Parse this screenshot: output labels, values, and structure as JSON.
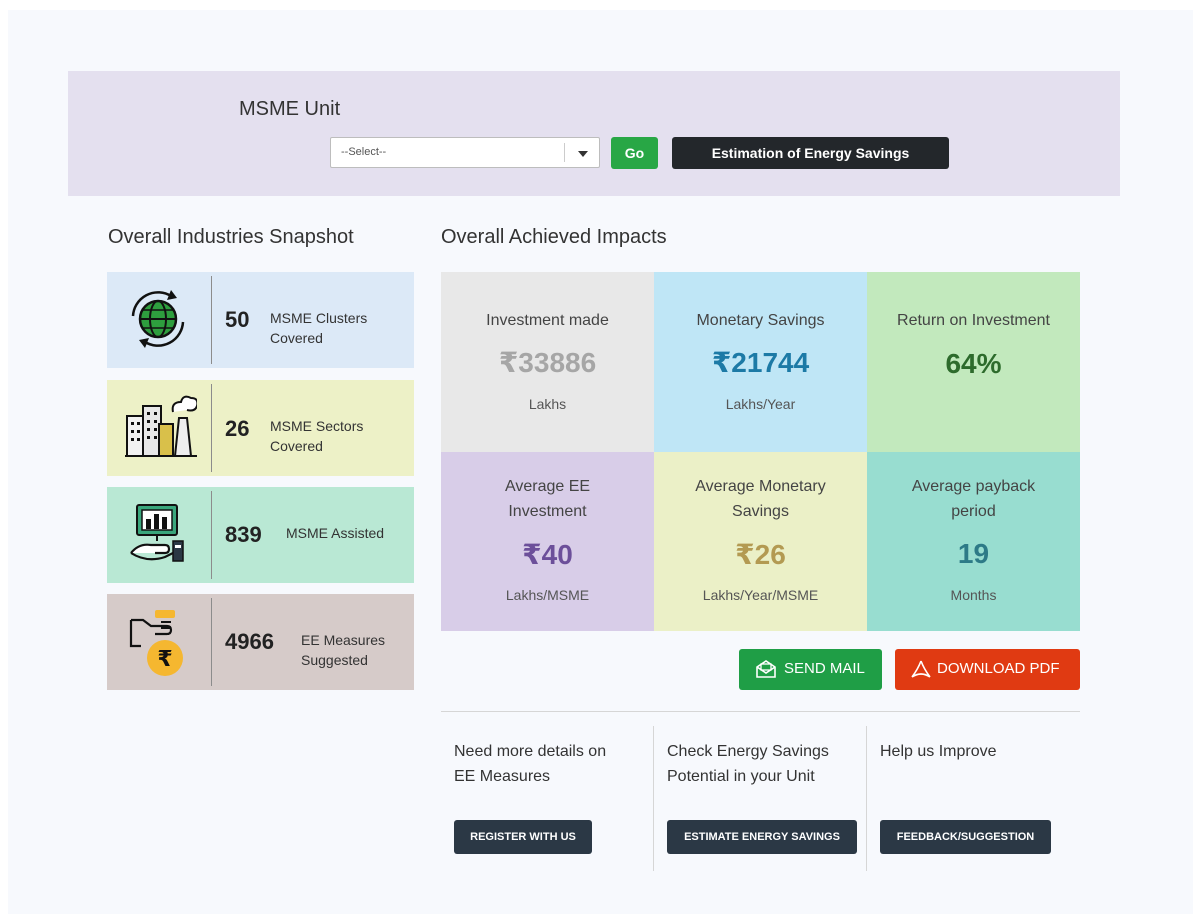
{
  "unit_panel": {
    "title": "MSME Unit",
    "select_value": "--Select--",
    "go_label": "Go",
    "estimation_label": "Estimation of Energy Savings"
  },
  "snapshot": {
    "title": "Overall Industries Snapshot",
    "cards": [
      {
        "number": "50",
        "label_line1": "MSME Clusters",
        "label_line2": "Covered",
        "icon": "globe-refresh-icon",
        "bg": "#dce9f7"
      },
      {
        "number": "26",
        "label_line1": "MSME Sectors",
        "label_line2": "Covered",
        "icon": "factory-buildings-icon",
        "bg": "#edf1c7"
      },
      {
        "number": "839",
        "label_line1": "MSME Assisted",
        "label_line2": "",
        "icon": "hand-chart-icon",
        "bg": "#b9e8d4"
      },
      {
        "number": "4966",
        "label_line1": "EE Measures",
        "label_line2": "Suggested",
        "icon": "rupee-bag-hand-icon",
        "bg": "#d6cbc9"
      }
    ]
  },
  "impacts": {
    "title": "Overall Achieved Impacts",
    "tiles": [
      {
        "label": "Investment made",
        "value": "₹33886",
        "unit": "Lakhs",
        "bg": "#e8e8e8",
        "color": "#a6a6a6"
      },
      {
        "label": "Monetary Savings",
        "value": "₹21744",
        "unit": "Lakhs/Year",
        "bg": "#bfe6f6",
        "color": "#1c7aa6"
      },
      {
        "label": "Return on Investment",
        "value": "64%",
        "unit": "",
        "bg": "#c2e9bd",
        "color": "#2d6b2c"
      },
      {
        "label_line1": "Average EE",
        "label_line2": "Investment",
        "value": "₹40",
        "unit": "Lakhs/MSME",
        "bg": "#d8cde8",
        "color": "#6c4f9a"
      },
      {
        "label_line1": "Average Monetary",
        "label_line2": "Savings",
        "value": "₹26",
        "unit": "Lakhs/Year/MSME",
        "bg": "#ebf0c7",
        "color": "#b39a52"
      },
      {
        "label_line1": "Average payback",
        "label_line2": "period",
        "value": "19",
        "unit": "Months",
        "bg": "#98ddd0",
        "color": "#2d7a87"
      }
    ],
    "send_mail": "SEND MAIL",
    "download_pdf": "DOWNLOAD PDF"
  },
  "cta": [
    {
      "text_line1": "Need more details on",
      "text_line2": "EE Measures",
      "button": "REGISTER WITH US"
    },
    {
      "text_line1": "Check Energy Savings",
      "text_line2": "Potential in your Unit",
      "button": "ESTIMATE ENERGY SAVINGS"
    },
    {
      "text_line1": "Help us Improve",
      "text_line2": "",
      "button": "FEEDBACK/SUGGESTION"
    }
  ]
}
